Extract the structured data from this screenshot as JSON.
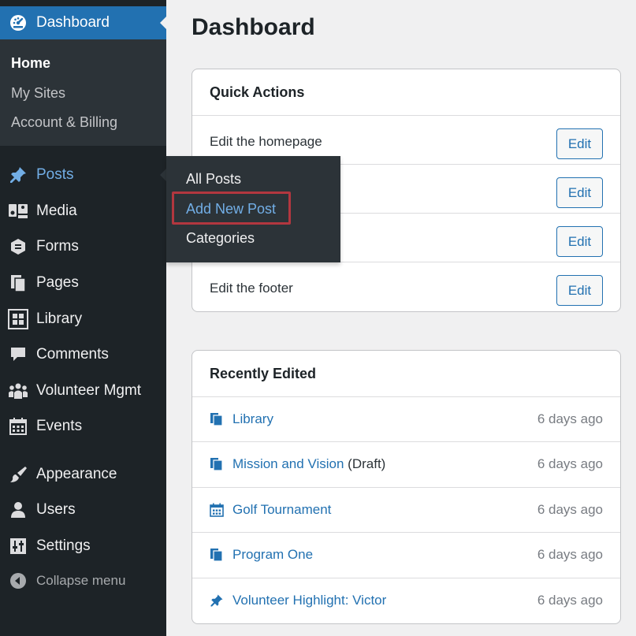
{
  "sidebar": {
    "dashboard_label": "Dashboard",
    "submenu": [
      "Home",
      "My Sites",
      "Account & Billing"
    ],
    "items": [
      {
        "label": "Posts",
        "icon": "pin-icon"
      },
      {
        "label": "Media",
        "icon": "media-icon"
      },
      {
        "label": "Forms",
        "icon": "forms-icon"
      },
      {
        "label": "Pages",
        "icon": "pages-icon"
      },
      {
        "label": "Library",
        "icon": "library-icon"
      },
      {
        "label": "Comments",
        "icon": "comments-icon"
      },
      {
        "label": "Volunteer Mgmt",
        "icon": "groups-icon"
      },
      {
        "label": "Events",
        "icon": "calendar-icon"
      },
      {
        "label": "Appearance",
        "icon": "brush-icon"
      },
      {
        "label": "Users",
        "icon": "users-icon"
      },
      {
        "label": "Settings",
        "icon": "settings-icon"
      },
      {
        "label": "Collapse menu",
        "icon": "collapse-icon"
      }
    ]
  },
  "flyout": {
    "items": [
      "All Posts",
      "Add New Post",
      "Categories"
    ]
  },
  "main": {
    "title": "Dashboard",
    "quick_actions": {
      "heading": "Quick Actions",
      "rows": [
        {
          "text": "Edit the homepage",
          "button": "Edit"
        },
        {
          "text": "",
          "button": "Edit"
        },
        {
          "text": "",
          "button": "Edit"
        },
        {
          "text": "Edit the footer",
          "button": "Edit"
        }
      ]
    },
    "recently_edited": {
      "heading": "Recently Edited",
      "rows": [
        {
          "title": "Library",
          "suffix": "",
          "time": "6 days ago",
          "icon": "page-icon"
        },
        {
          "title": "Mission and Vision",
          "suffix": " (Draft)",
          "time": "6 days ago",
          "icon": "page-icon"
        },
        {
          "title": "Golf Tournament",
          "suffix": "",
          "time": "6 days ago",
          "icon": "calendar-icon"
        },
        {
          "title": "Program One",
          "suffix": "",
          "time": "6 days ago",
          "icon": "page-icon"
        },
        {
          "title": "Volunteer Highlight: Victor",
          "suffix": "",
          "time": "6 days ago",
          "icon": "pin-icon"
        }
      ]
    }
  },
  "colors": {
    "sidebar_bg": "#1d2327",
    "submenu_bg": "#2c3338",
    "accent": "#2271b1",
    "link_hover": "#72aee6",
    "highlight_border": "#b2373f"
  }
}
